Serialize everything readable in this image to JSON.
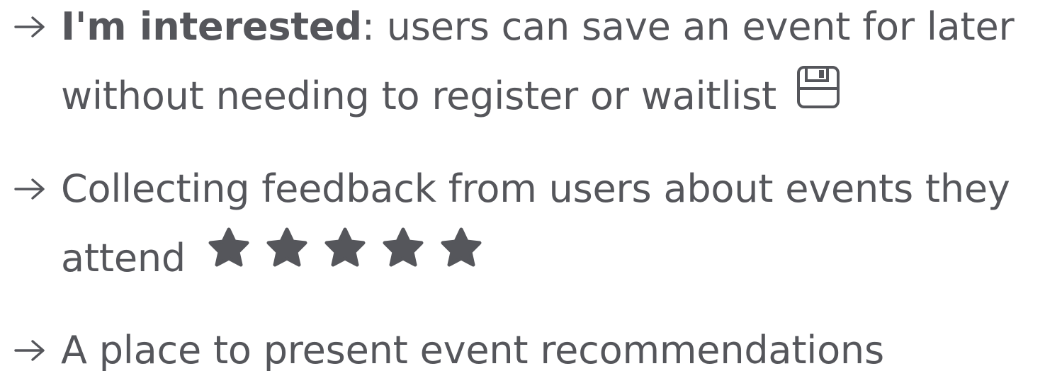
{
  "colors": {
    "text": "#55565b",
    "icon": "#55565b"
  },
  "items": [
    {
      "arrow_icon": "right-arrow-icon",
      "bold_term": "I'm interested",
      "line1_rest": ": users can save an event for later",
      "line2": "without needing to register or waitlist",
      "trailing_icon": "floppy-disk-icon"
    },
    {
      "arrow_icon": "right-arrow-icon",
      "line1": "Collecting feedback from users about events they",
      "line2": "attend",
      "rating_stars": 5,
      "trailing_icon": "star-icon"
    },
    {
      "arrow_icon": "right-arrow-icon",
      "line1": "A place to present event recommendations"
    }
  ]
}
